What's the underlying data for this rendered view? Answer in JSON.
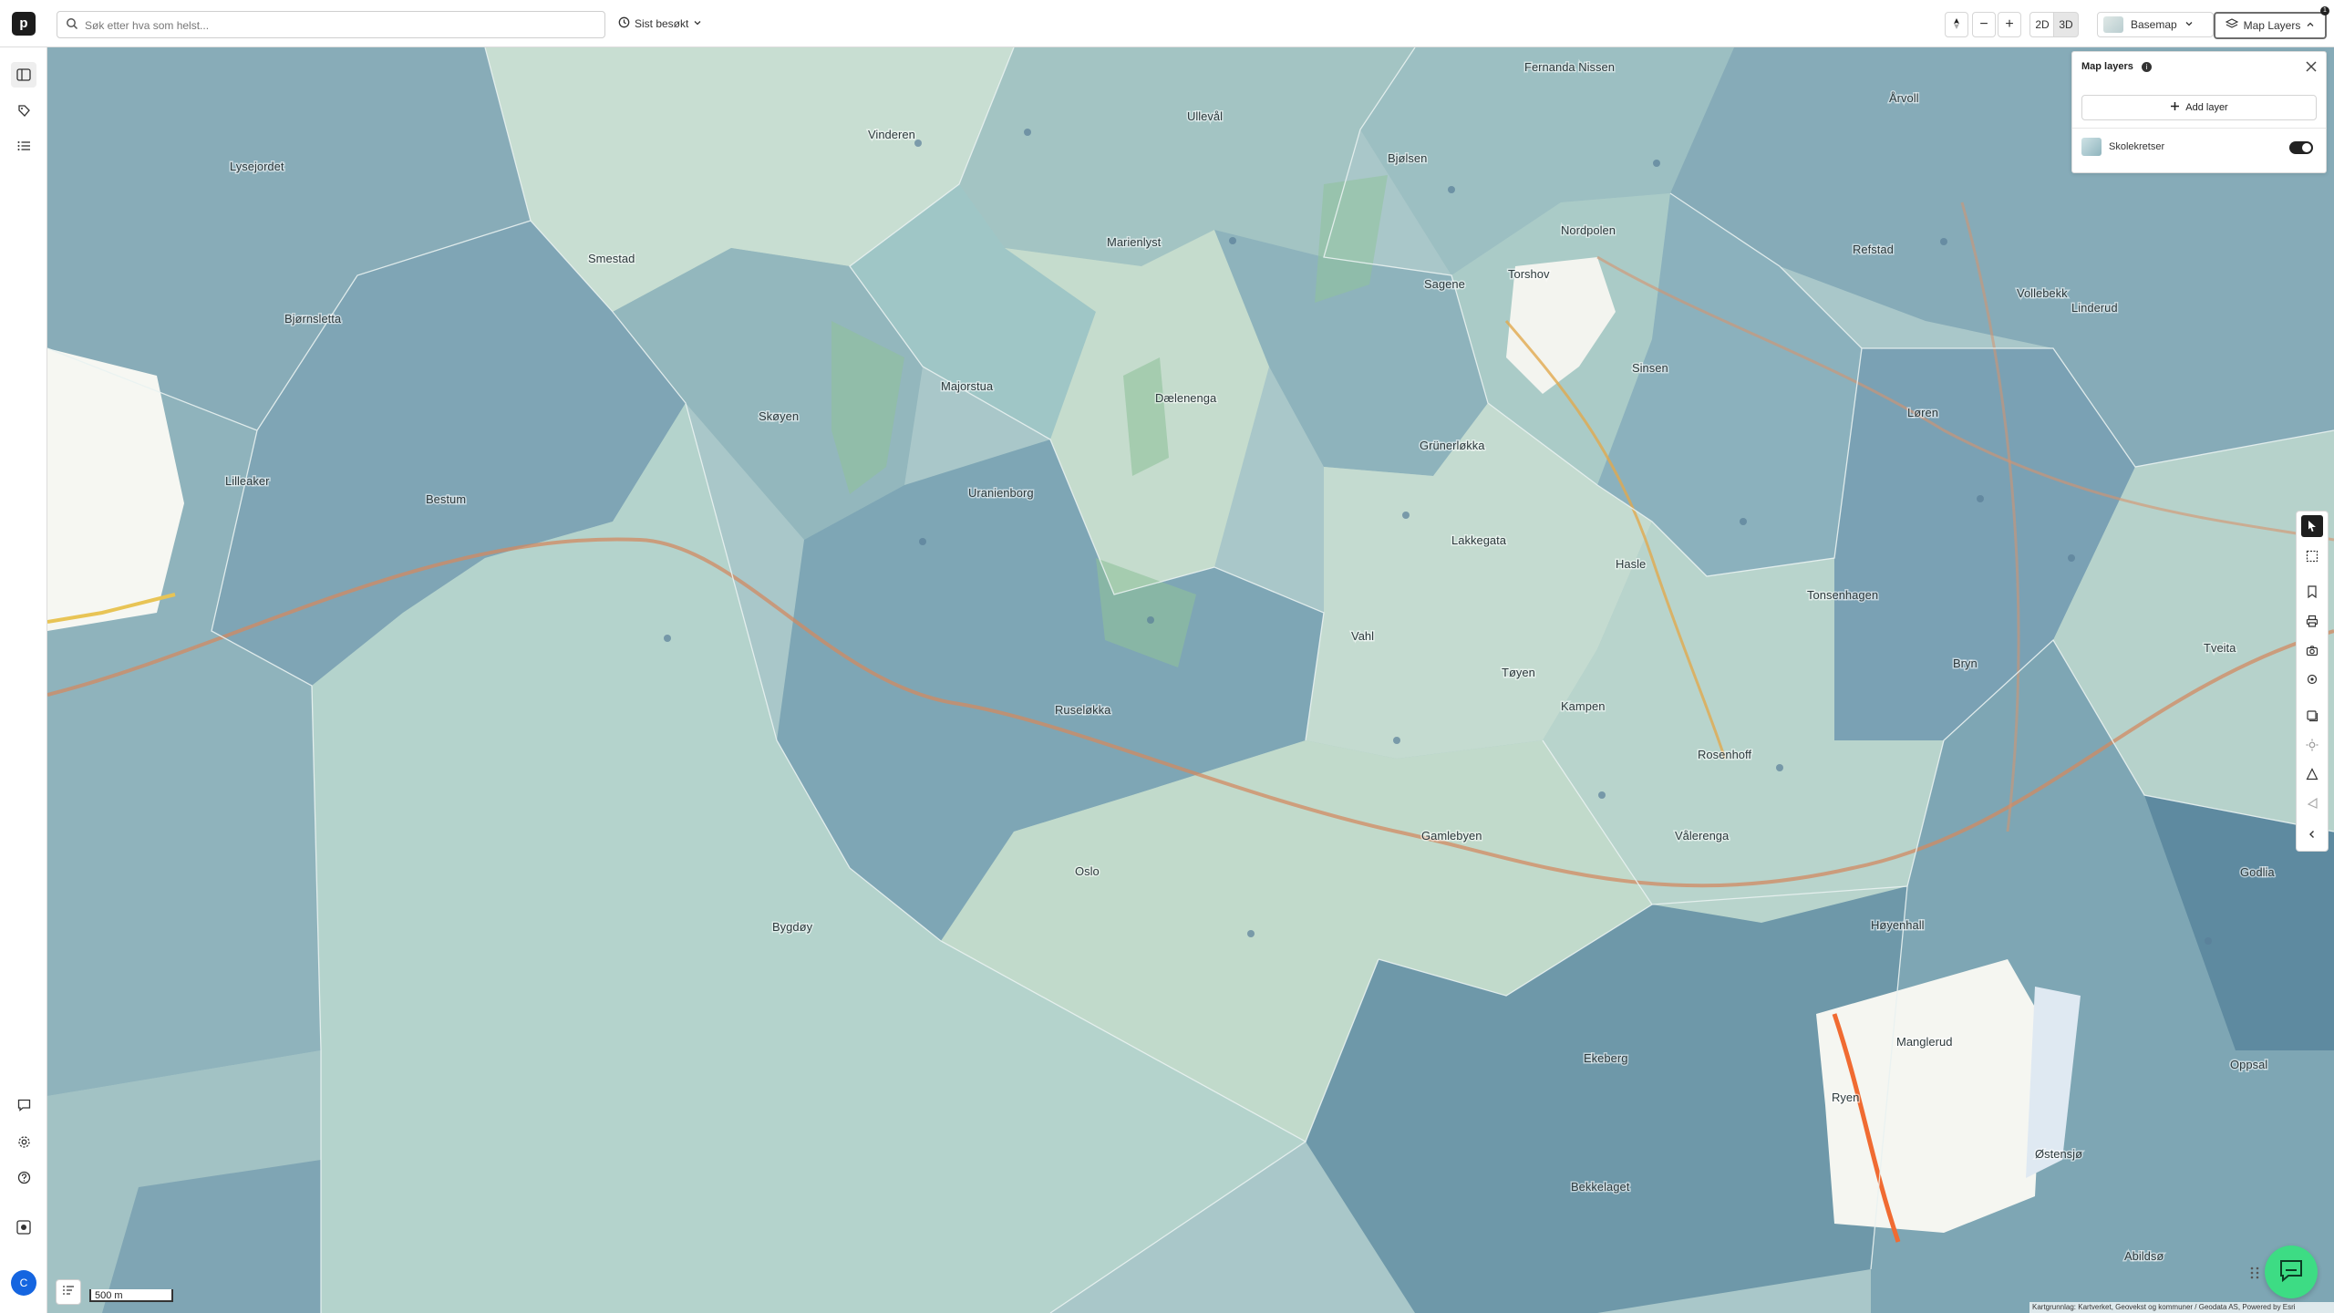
{
  "topbar": {
    "logo_letter": "p",
    "search_placeholder": "Søk etter hva som helst...",
    "recent_label": "Sist besøkt",
    "zoom_out_label": "−",
    "zoom_in_label": "+",
    "mode_2d_label": "2D",
    "mode_3d_label": "3D",
    "basemap_label": "Basemap",
    "map_layers_label": "Map Layers",
    "map_layers_badge": "1"
  },
  "left_rail": {
    "items": [
      "book-icon",
      "tag-icon",
      "list-icon"
    ],
    "bottom_items": [
      "chat-icon",
      "gear-icon",
      "help-icon",
      "record-icon"
    ],
    "user_initial": "C"
  },
  "layers_panel": {
    "title": "Map layers",
    "info_badge": "i",
    "add_layer_label": "Add layer",
    "layers": [
      {
        "name": "Skolekretser",
        "visible": true
      }
    ]
  },
  "map": {
    "place_labels": [
      "Fernanda Nissen",
      "Ullevål",
      "Vinderen",
      "Lysejordet",
      "Smestad",
      "Marienlyst",
      "Bjølsen",
      "Torshov",
      "Nordpolen",
      "Refstad",
      "Årvoll",
      "Bjørnsletta",
      "Sagene",
      "Vollebekk",
      "Linderud",
      "Majorstua",
      "Skøyen",
      "Dælenenga",
      "Sinsen",
      "Lilleaker",
      "Bestum",
      "Grünerløkka",
      "Uranienborg",
      "Løren",
      "Lakkegata",
      "Hasle",
      "Tonsenhagen",
      "Vahl",
      "Tøyen",
      "Bryn",
      "Tveita",
      "Ruseløkka",
      "Kampen",
      "Rosenhoff",
      "Gamlebyen",
      "Vålerenga",
      "Oslo",
      "Bygdøy",
      "Høyenhall",
      "Godlia",
      "Ekeberg",
      "Manglerud",
      "Ryen",
      "Østensjø",
      "Oppsal",
      "Bekkelaget",
      "Abildsø"
    ]
  },
  "bottom": {
    "scale_label": "500 m",
    "attribution": "Kartgrunnlag: Kartverket, Geovekst og kommuner / Geodata AS, Powered by Esri"
  }
}
